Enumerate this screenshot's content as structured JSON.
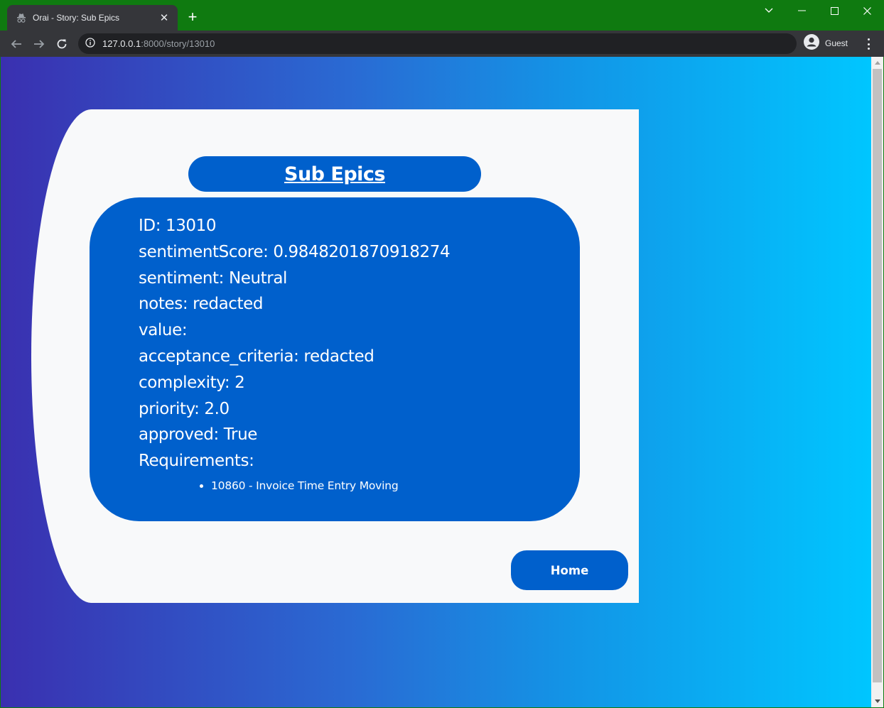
{
  "browser": {
    "tab_title": "Orai - Story: Sub Epics",
    "url_host": "127.0.0.1",
    "url_rest": ":8000/story/13010",
    "profile_label": "Guest",
    "colors": {
      "frame": "#0f7a10",
      "toolbar": "#35363a",
      "omnibox": "#202124"
    }
  },
  "page": {
    "heading": "Sub Epics",
    "fields": [
      {
        "label": "ID",
        "value": "13010"
      },
      {
        "label": "sentimentScore",
        "value": "0.9848201870918274"
      },
      {
        "label": "sentiment",
        "value": "Neutral"
      },
      {
        "label": "notes",
        "value": "redacted"
      },
      {
        "label": "value",
        "value": ""
      },
      {
        "label": "acceptance_criteria",
        "value": "redacted"
      },
      {
        "label": "complexity",
        "value": "2"
      },
      {
        "label": "priority",
        "value": "2.0"
      },
      {
        "label": "approved",
        "value": "True"
      }
    ],
    "requirements_label": "Requirements:",
    "requirements": [
      "10860 - Invoice Time Entry Moving"
    ],
    "home_button": "Home",
    "colors": {
      "accent": "#0060cc",
      "card": "#f8f9fa",
      "gradient_start": "#3a30b0",
      "gradient_end": "#00c6ff"
    }
  }
}
